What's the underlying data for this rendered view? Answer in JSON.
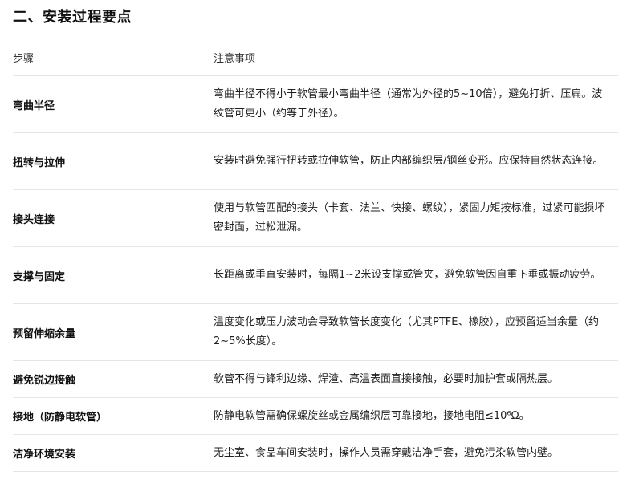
{
  "section_title": "二、安装过程要点",
  "table": {
    "headers": [
      "步骤",
      "注意事项"
    ],
    "rows": [
      [
        "弯曲半径",
        "弯曲半径不得小于软管最小弯曲半径（通常为外径的5~10倍），避免打折、压扁。波纹管可更小（约等于外径）。"
      ],
      [
        "扭转与拉伸",
        "安装时避免强行扭转或拉伸软管，防止内部编织层/钢丝变形。应保持自然状态连接。"
      ],
      [
        "接头连接",
        "使用与软管匹配的接头（卡套、法兰、快接、螺纹），紧固力矩按标准，过紧可能损坏密封面，过松泄漏。"
      ],
      [
        "支撑与固定",
        "长距离或垂直安装时，每隔1~2米设支撑或管夹，避免软管因自重下垂或振动疲劳。"
      ],
      [
        "预留伸缩余量",
        "温度变化或压力波动会导致软管长度变化（尤其PTFE、橡胶），应预留适当余量（约2~5%长度）。"
      ],
      [
        "避免锐边接触",
        "软管不得与锋利边缘、焊渣、高温表面直接接触，必要时加护套或隔热层。"
      ],
      [
        "接地（防静电软管）",
        "防静电软管需确保螺旋丝或金属编织层可靠接地，接地电阻≤10⁶Ω。"
      ],
      [
        "洁净环境安装",
        "无尘室、食品车间安装时，操作人员需穿戴洁净手套，避免污染软管内壁。"
      ]
    ]
  }
}
